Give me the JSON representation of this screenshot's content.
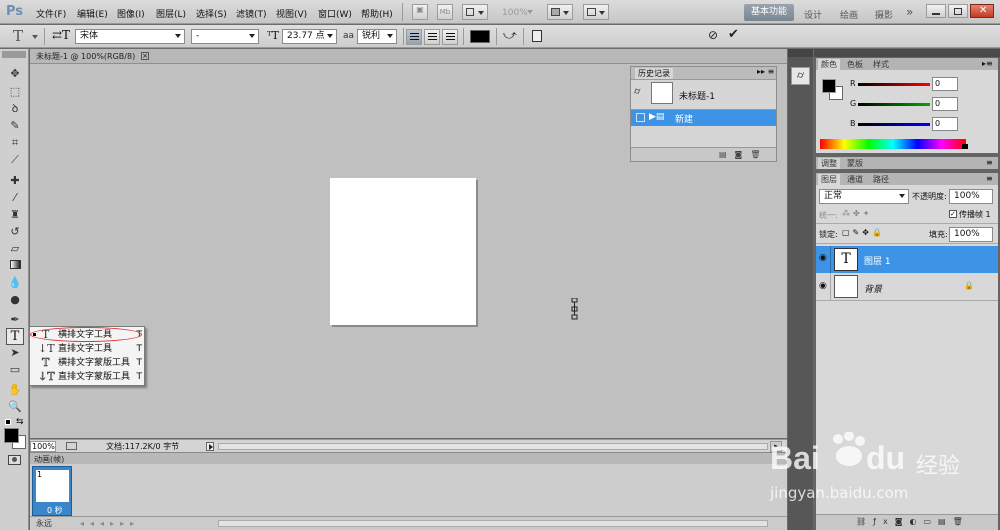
{
  "app": {
    "logo": "Ps"
  },
  "menu": [
    "文件(F)",
    "编辑(E)",
    "图像(I)",
    "图层(L)",
    "选择(S)",
    "滤镜(T)",
    "视图(V)",
    "窗口(W)",
    "帮助(H)"
  ],
  "menubar": {
    "mb_label": "Mb",
    "zoom": "100%",
    "workspace_active": "基本功能",
    "workspaces": [
      "设计",
      "绘画",
      "摄影"
    ],
    "more": "»"
  },
  "options": {
    "font_family": "宋体",
    "font_style": "-",
    "font_size": "23.77 点",
    "aa_label": "aa",
    "aa_mode": "锐利"
  },
  "document": {
    "tab_title": "未标题-1 @ 100%(RGB/8)",
    "zoom": "100%",
    "doc_info": "文档:117.2K/0 字节"
  },
  "history": {
    "title": "历史记录",
    "snapshot": "未标题-1",
    "state": "新建"
  },
  "color_panel": {
    "tabs": [
      "颜色",
      "色板",
      "样式"
    ],
    "r_label": "R",
    "g_label": "G",
    "b_label": "B",
    "r": "0",
    "g": "0",
    "b": "0"
  },
  "adjust_panel": {
    "tabs": [
      "调整",
      "蒙版"
    ]
  },
  "layers_panel": {
    "tabs": [
      "图层",
      "通道",
      "路径"
    ],
    "blend_mode": "正常",
    "opacity_label": "不透明度:",
    "opacity": "100%",
    "unify_label": "统一:",
    "propagate_label": "传播帧 1",
    "lock_label": "锁定:",
    "fill_label": "填充:",
    "fill": "100%",
    "layers": [
      {
        "name": "图层 1",
        "thumb": "T"
      },
      {
        "name": "背景"
      }
    ]
  },
  "tool_popup": {
    "items": [
      {
        "label": "横排文字工具",
        "shortcut": "T",
        "icon": "T"
      },
      {
        "label": "直排文字工具",
        "shortcut": "T",
        "icon": "↓T"
      },
      {
        "label": "横排文字蒙版工具",
        "shortcut": "T",
        "icon": "T"
      },
      {
        "label": "直排文字蒙版工具",
        "shortcut": "T",
        "icon": "↓T"
      }
    ]
  },
  "animation": {
    "title": "动画(帧)",
    "frame_num": "1",
    "frame_delay": "0 秒",
    "loop": "永远"
  },
  "watermark": {
    "brand": "Bai",
    "brand2": "du",
    "product": "经验",
    "url": "jingyan.baidu.com"
  }
}
